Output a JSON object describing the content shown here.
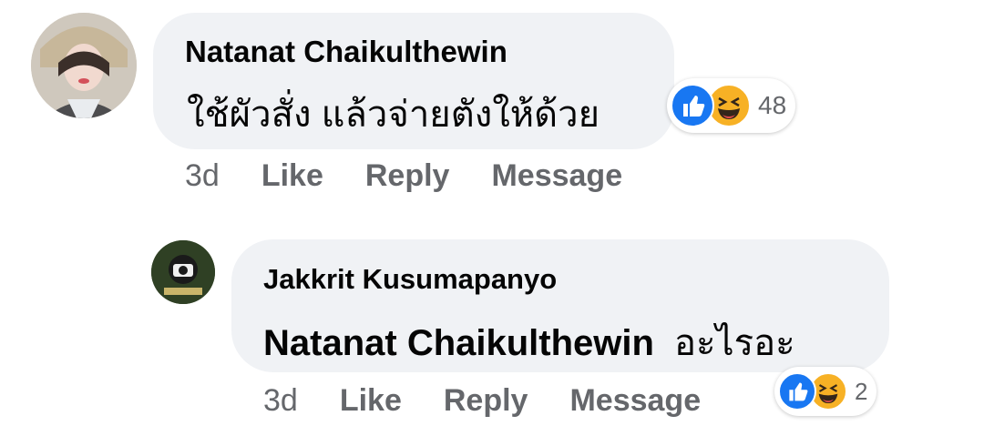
{
  "comments": [
    {
      "author": "Natanat Chaikulthewin",
      "text": "ใช้ผัวสั่ง แล้วจ่ายตังให้ด้วย",
      "time": "3d",
      "like_label": "Like",
      "reply_label": "Reply",
      "message_label": "Message",
      "reactions": {
        "icons": [
          "like-icon",
          "haha-icon"
        ],
        "count": "48"
      }
    },
    {
      "author": "Jakkrit Kusumapanyo",
      "mention": "Natanat Chaikulthewin",
      "text": "อะไรอะ",
      "time": "3d",
      "like_label": "Like",
      "reply_label": "Reply",
      "message_label": "Message",
      "reactions": {
        "icons": [
          "like-icon",
          "haha-icon"
        ],
        "count": "2"
      }
    }
  ],
  "colors": {
    "bubble": "#f0f2f5",
    "like": "#1877f2",
    "haha": "#f7b125",
    "meta": "#65676b"
  }
}
